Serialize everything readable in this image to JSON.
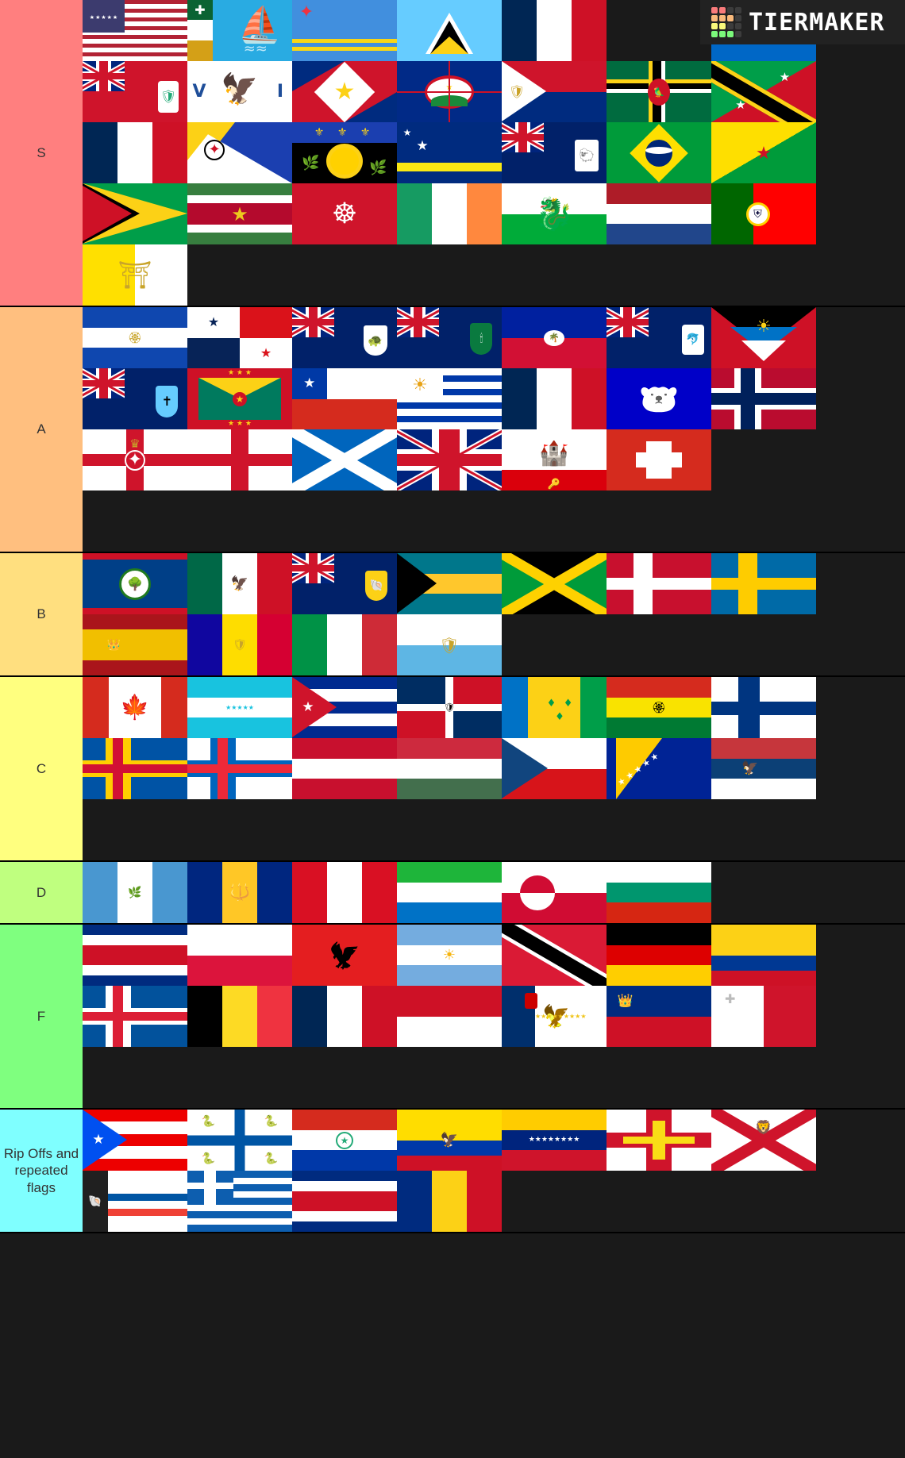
{
  "app": {
    "logo_text": "TIERMAKER",
    "logo_name": "tiermaker-logo"
  },
  "logo_colors": [
    "#f97b7b",
    "#f97b7b",
    "#3c3c3c",
    "#3c3c3c",
    "#f9b97b",
    "#f9b97b",
    "#f9b97b",
    "#3c3c3c",
    "#f9f97b",
    "#f9f97b",
    "#3c3c3c",
    "#3c3c3c",
    "#7bf97b",
    "#7bf97b",
    "#7bf97b",
    "#3c3c3c"
  ],
  "tiers": [
    {
      "label": "S",
      "color": "#ff7f7f",
      "items": [
        {
          "name": "united-states",
          "type": "usa"
        },
        {
          "name": "saint-pierre-and-miquelon",
          "type": "spm"
        },
        {
          "name": "aruba",
          "type": "aruba"
        },
        {
          "name": "saint-lucia",
          "type": "stlucia"
        },
        {
          "name": "france",
          "type": "france"
        },
        {
          "name": "empty",
          "type": "empty"
        },
        {
          "name": "nicaragua",
          "type": "nicaragua"
        },
        {
          "name": "bermuda",
          "type": "bermuda"
        },
        {
          "name": "us-virgin-islands",
          "type": "usvi"
        },
        {
          "name": "saba",
          "type": "saba"
        },
        {
          "name": "sint-eustatius",
          "type": "statia"
        },
        {
          "name": "sint-maarten",
          "type": "sintmaarten"
        },
        {
          "name": "dominica",
          "type": "dominica"
        },
        {
          "name": "saint-kitts-and-nevis",
          "type": "skn"
        },
        {
          "name": "france-2",
          "type": "france"
        },
        {
          "name": "bonaire",
          "type": "bonaire"
        },
        {
          "name": "guadeloupe",
          "type": "guadeloupe"
        },
        {
          "name": "curacao",
          "type": "curacao"
        },
        {
          "name": "falkland-islands",
          "type": "falkland"
        },
        {
          "name": "brazil",
          "type": "brazil"
        },
        {
          "name": "french-guiana",
          "type": "frenchguiana"
        },
        {
          "name": "guyana",
          "type": "guyana"
        },
        {
          "name": "suriname",
          "type": "suriname"
        },
        {
          "name": "isle-of-man",
          "type": "isleofman"
        },
        {
          "name": "ireland",
          "type": "ireland"
        },
        {
          "name": "wales",
          "type": "wales"
        },
        {
          "name": "netherlands",
          "type": "netherlands"
        },
        {
          "name": "portugal",
          "type": "portugal"
        },
        {
          "name": "vatican-city",
          "type": "vatican"
        },
        {
          "name": "empty",
          "type": "empty"
        }
      ]
    },
    {
      "label": "A",
      "color": "#ffbf7f",
      "items": [
        {
          "name": "el-salvador",
          "type": "elsalvador"
        },
        {
          "name": "panama",
          "type": "panama"
        },
        {
          "name": "cayman-islands",
          "type": "cayman"
        },
        {
          "name": "british-virgin-islands",
          "type": "bvi"
        },
        {
          "name": "haiti",
          "type": "haiti"
        },
        {
          "name": "anguilla",
          "type": "anguilla"
        },
        {
          "name": "antigua-and-barbuda",
          "type": "antigua"
        },
        {
          "name": "montserrat",
          "type": "montserrat"
        },
        {
          "name": "grenada",
          "type": "grenada"
        },
        {
          "name": "chile",
          "type": "chile"
        },
        {
          "name": "uruguay",
          "type": "uruguay"
        },
        {
          "name": "france-3",
          "type": "france"
        },
        {
          "name": "greenland-bear",
          "type": "nunavutbear"
        },
        {
          "name": "norway",
          "type": "norway"
        },
        {
          "name": "northern-ireland",
          "type": "nireland"
        },
        {
          "name": "england",
          "type": "england"
        },
        {
          "name": "scotland",
          "type": "scotland"
        },
        {
          "name": "united-kingdom",
          "type": "uk"
        },
        {
          "name": "gibraltar",
          "type": "gibraltar"
        },
        {
          "name": "switzerland",
          "type": "switzerland"
        }
      ]
    },
    {
      "label": "B",
      "color": "#ffdf7f",
      "items": [
        {
          "name": "belize",
          "type": "belize"
        },
        {
          "name": "mexico",
          "type": "mexico"
        },
        {
          "name": "turks-and-caicos",
          "type": "turks"
        },
        {
          "name": "bahamas",
          "type": "bahamas"
        },
        {
          "name": "jamaica",
          "type": "jamaica"
        },
        {
          "name": "denmark",
          "type": "denmark"
        },
        {
          "name": "sweden",
          "type": "sweden"
        },
        {
          "name": "spain",
          "type": "spain"
        },
        {
          "name": "andorra",
          "type": "andorra"
        },
        {
          "name": "italy",
          "type": "italy"
        },
        {
          "name": "san-marino",
          "type": "sanmarino"
        },
        {
          "name": "empty",
          "type": "empty"
        }
      ]
    },
    {
      "label": "C",
      "color": "#ffff7f",
      "items": [
        {
          "name": "canada",
          "type": "canada"
        },
        {
          "name": "honduras",
          "type": "honduras"
        },
        {
          "name": "cuba",
          "type": "cuba"
        },
        {
          "name": "dominican-republic",
          "type": "domrep"
        },
        {
          "name": "saint-vincent-and-the-grenadines",
          "type": "svg"
        },
        {
          "name": "bolivia",
          "type": "bolivia"
        },
        {
          "name": "finland",
          "type": "finland"
        },
        {
          "name": "aland-islands",
          "type": "aland"
        },
        {
          "name": "faroe-islands",
          "type": "faroe"
        },
        {
          "name": "austria",
          "type": "austria"
        },
        {
          "name": "hungary",
          "type": "hungary"
        },
        {
          "name": "czechia",
          "type": "czechia"
        },
        {
          "name": "bosnia-and-herzegovina",
          "type": "bosnia"
        },
        {
          "name": "serbia",
          "type": "serbia"
        }
      ]
    },
    {
      "label": "D",
      "color": "#bfff7f",
      "items": [
        {
          "name": "guatemala",
          "type": "guatemala"
        },
        {
          "name": "barbados",
          "type": "barbados"
        },
        {
          "name": "peru",
          "type": "peru"
        },
        {
          "name": "sierra-leone",
          "type": "sierraleone"
        },
        {
          "name": "greenland",
          "type": "greenland"
        },
        {
          "name": "bulgaria",
          "type": "bulgaria"
        }
      ]
    },
    {
      "label": "F",
      "color": "#7fff7f",
      "items": [
        {
          "name": "costa-rica",
          "type": "costarica"
        },
        {
          "name": "poland",
          "type": "poland"
        },
        {
          "name": "albania",
          "type": "albania"
        },
        {
          "name": "argentina",
          "type": "argentina"
        },
        {
          "name": "trinidad-and-tobago",
          "type": "trinidad"
        },
        {
          "name": "germany",
          "type": "germany"
        },
        {
          "name": "colombia",
          "type": "colombia"
        },
        {
          "name": "iceland",
          "type": "iceland"
        },
        {
          "name": "belgium",
          "type": "belgium"
        },
        {
          "name": "french-vertical",
          "type": "france"
        },
        {
          "name": "indonesia",
          "type": "indonesia"
        },
        {
          "name": "azores",
          "type": "azores"
        },
        {
          "name": "liechtenstein",
          "type": "liechtenstein"
        },
        {
          "name": "malta",
          "type": "malta"
        }
      ]
    },
    {
      "label": "Rip Offs and repeated flags",
      "color": "#7fffff",
      "items": [
        {
          "name": "puerto-rico",
          "type": "puertorico"
        },
        {
          "name": "saint-barthelemy",
          "type": "stbarth"
        },
        {
          "name": "paraguay",
          "type": "paraguay"
        },
        {
          "name": "ecuador",
          "type": "ecuador"
        },
        {
          "name": "venezuela",
          "type": "venezuela"
        },
        {
          "name": "guernsey",
          "type": "guernsey"
        },
        {
          "name": "jersey",
          "type": "jersey"
        },
        {
          "name": "saint-martin",
          "type": "stmartin"
        },
        {
          "name": "greece",
          "type": "greece"
        },
        {
          "name": "costa-rica-2",
          "type": "costarica"
        },
        {
          "name": "romania",
          "type": "romania"
        },
        {
          "name": "empty",
          "type": "empty"
        }
      ]
    }
  ]
}
